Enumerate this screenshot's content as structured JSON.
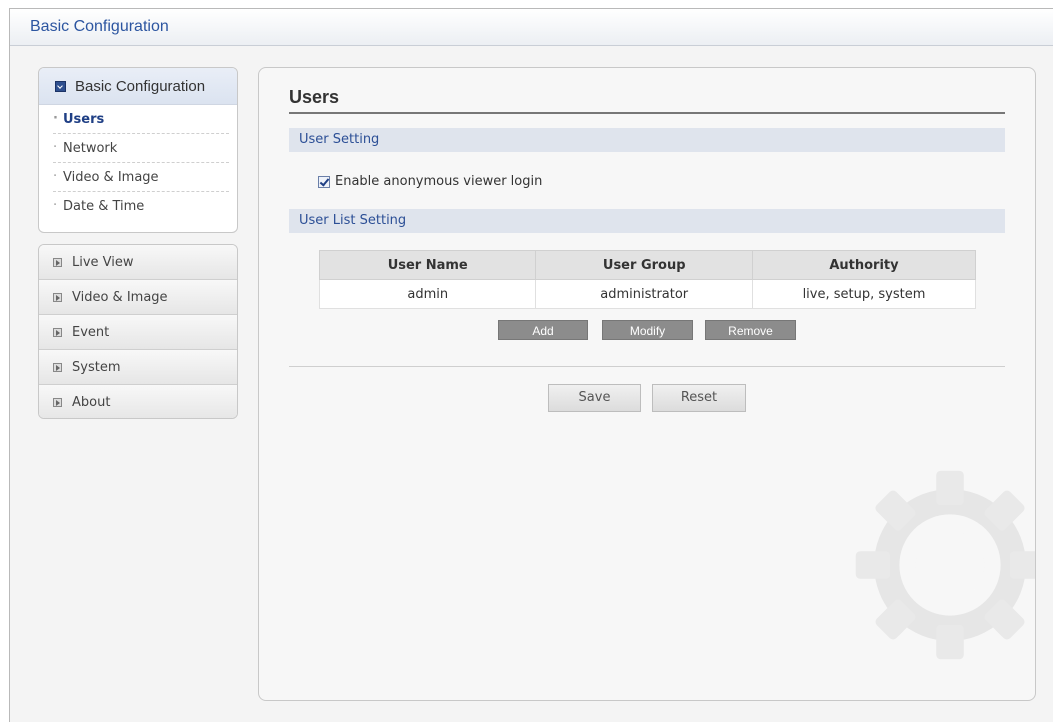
{
  "header": {
    "title": "Basic Configuration"
  },
  "sidebar": {
    "group_title": "Basic Configuration",
    "sub_items": [
      {
        "label": "Users",
        "active": true
      },
      {
        "label": "Network",
        "active": false
      },
      {
        "label": "Video & Image",
        "active": false
      },
      {
        "label": "Date & Time",
        "active": false
      }
    ],
    "menu": [
      {
        "label": "Live View"
      },
      {
        "label": "Video & Image"
      },
      {
        "label": "Event"
      },
      {
        "label": "System"
      },
      {
        "label": "About"
      }
    ]
  },
  "main": {
    "title": "Users",
    "user_setting": {
      "section_label": "User Setting",
      "anonymous_login_label": "Enable anonymous viewer login",
      "anonymous_login_checked": true
    },
    "user_list": {
      "section_label": "User List Setting",
      "columns": [
        "User Name",
        "User Group",
        "Authority"
      ],
      "rows": [
        [
          "admin",
          "administrator",
          "live, setup, system"
        ]
      ],
      "buttons": {
        "add": "Add",
        "modify": "Modify",
        "remove": "Remove"
      }
    },
    "actions": {
      "save": "Save",
      "reset": "Reset"
    }
  },
  "colors": {
    "accent": "#2c55a0",
    "section_bar": "#dfe4ed",
    "dark_button": "#8c8c8c"
  }
}
